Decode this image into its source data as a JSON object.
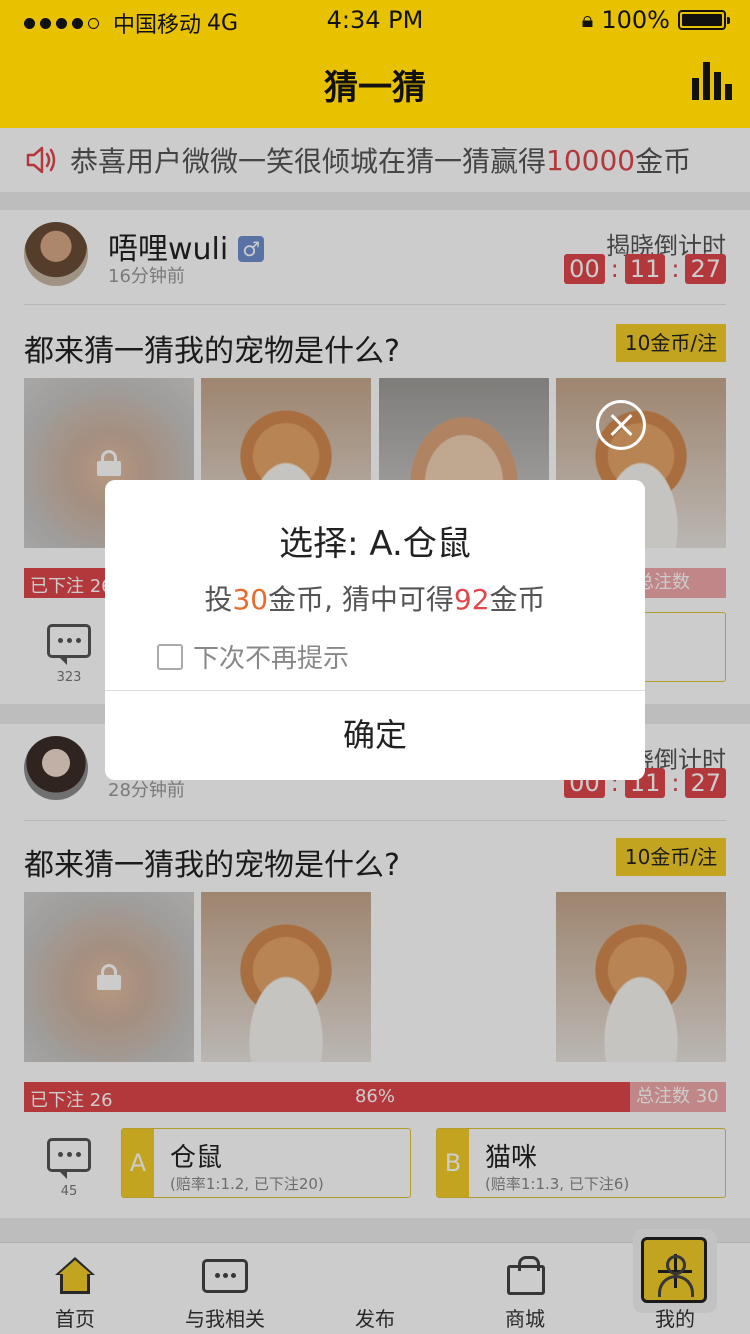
{
  "status_bar": {
    "carrier": "中国移动",
    "network": "4G",
    "time": "4:34 PM",
    "battery": "100%"
  },
  "header": {
    "title": "猜一猜",
    "ranking_icon": "bar-chart-icon"
  },
  "notice": {
    "prefix": "恭喜用户微微一笑很倾城在猜一猜赢得",
    "amount": "10000",
    "suffix": "金币"
  },
  "posts": [
    {
      "username": "唔哩wuli",
      "gender": "♂",
      "time": "16分钟前",
      "countdown_label": "揭晓倒计时",
      "countdown": [
        "00",
        "11",
        "27"
      ],
      "question": "都来猜一猜我的宠物是什么?",
      "price": "10金币/注",
      "bar": {
        "left": "已下注 26",
        "right": "总注数 500"
      },
      "comments": "323"
    },
    {
      "username": "",
      "time": "28分钟前",
      "countdown_label": "揭晓倒计时",
      "countdown": [
        "00",
        "11",
        "27"
      ],
      "question": "都来猜一猜我的宠物是什么?",
      "price": "10金币/注",
      "bar": {
        "left": "已下注 26",
        "middle": "86%",
        "right": "总注数 30",
        "progress": 0.86
      },
      "comments": "45",
      "options": [
        {
          "letter": "A",
          "name": "仓鼠",
          "odds": "(赔率1:1.2, 已下注20)"
        },
        {
          "letter": "B",
          "name": "猫咪",
          "odds": "(赔率1:1.3, 已下注6)"
        }
      ]
    }
  ],
  "dialog": {
    "title": "选择: A.仓鼠",
    "msg_a": "投",
    "bet": "30",
    "msg_b": "金币, 猜中可得",
    "reward": "92",
    "msg_c": "金币",
    "checkbox_label": "下次不再提示",
    "confirm": "确定"
  },
  "tabbar": {
    "home": "首页",
    "related": "与我相关",
    "publish": "发布",
    "mall": "商城",
    "mine": "我的"
  },
  "colors": {
    "brand": "#e8c100",
    "accent": "#e0474c",
    "orange": "#e96a2e"
  }
}
